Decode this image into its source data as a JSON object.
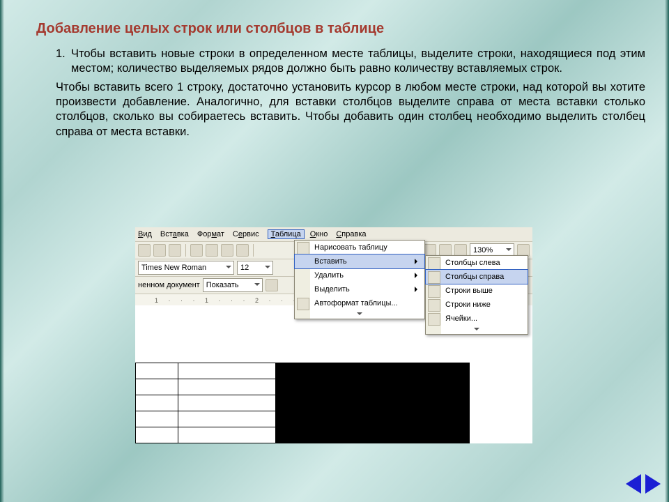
{
  "title": "Добавление целых строк или столбцов в таблице",
  "list": {
    "num1": "1.",
    "item1": "Чтобы вставить новые строки в определенном месте таблицы, выделите строки, находящиеся под этим местом; количество выделяемых рядов должно быть равно количеству вставляемых строк.",
    "item2": "Чтобы вставить всего 1 строку, достаточно установить курсор в любом месте строки, над которой вы хотите произвести добавление. Аналогично, для вставки столбцов выделите справа от места вставки столько столбцов, сколько вы собираетесь вставить. Чтобы добавить один столбец необходимо выделить столбец справа от места вставки."
  },
  "menubar": {
    "view": "Вид",
    "insert": "Вставка",
    "format": "Формат",
    "tools": "Сервис",
    "table": "Таблица",
    "window": "Окно",
    "help": "Справка"
  },
  "toolbar": {
    "font": "Times New Roman",
    "size": "12",
    "zoom": "130%",
    "doclabel": "ненном документ",
    "show": "Показать"
  },
  "ruler": "1 · · · 1 · · · 2 · · · 3",
  "menu_main": {
    "draw": "Нарисовать таблицу",
    "insert": "Вставить",
    "delete": "Удалить",
    "select": "Выделить",
    "autoformat": "Автоформат таблицы..."
  },
  "menu_sub": {
    "cols_left": "Столбцы слева",
    "cols_right": "Столбцы справа",
    "rows_above": "Строки выше",
    "rows_below": "Строки ниже",
    "cells": "Ячейки..."
  }
}
